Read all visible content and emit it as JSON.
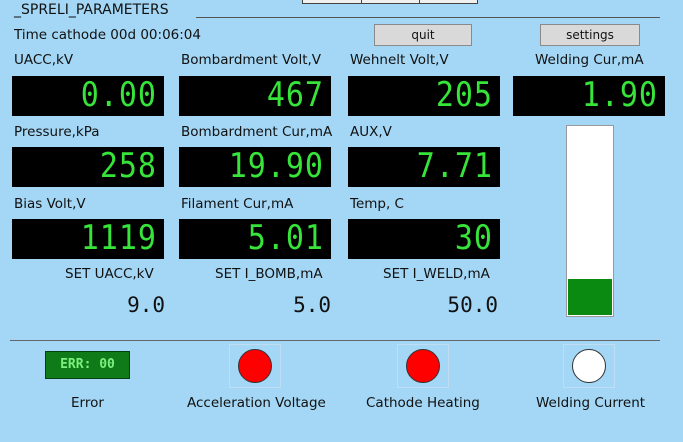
{
  "title": "_SPRELI_PARAMETERS",
  "time_cathode": "Time cathode 00d 00:06:04",
  "buttons": {
    "quit": "quit",
    "settings": "settings"
  },
  "readouts": [
    {
      "label": "UACC,kV",
      "value": "0.00"
    },
    {
      "label": "Bombardment Volt,V",
      "value": "467"
    },
    {
      "label": "Wehnelt Volt,V",
      "value": "205"
    },
    {
      "label": "Welding Cur,mA",
      "value": "1.90"
    },
    {
      "label": "Pressure,kPa",
      "value": "258"
    },
    {
      "label": "Bombardment Cur,mA",
      "value": "19.90"
    },
    {
      "label": "AUX,V",
      "value": "7.71"
    },
    {
      "label": "Bias Volt,V",
      "value": "1119"
    },
    {
      "label": "Filament Cur,mA",
      "value": "5.01"
    },
    {
      "label": "Temp, C",
      "value": "30"
    }
  ],
  "setpoints": [
    {
      "label": "SET UACC,kV",
      "value": "9.0"
    },
    {
      "label": "SET I_BOMB,mA",
      "value": "5.0"
    },
    {
      "label": "SET I_WELD,mA",
      "value": "50.0"
    }
  ],
  "welding_bar": {
    "fill_fraction": 0.19,
    "color": "#0a8a10"
  },
  "error": {
    "badge": "ERR: 00",
    "label": "Error"
  },
  "indicators": [
    {
      "label": "Acceleration Voltage",
      "color": "#ff0000"
    },
    {
      "label": "Cathode Heating",
      "color": "#ff0000"
    },
    {
      "label": "Welding Current",
      "color": "#ffffff"
    }
  ],
  "colors": {
    "background": "#a3d7f5",
    "lcd_text": "#36e43a",
    "lcd_bg": "#000000"
  }
}
